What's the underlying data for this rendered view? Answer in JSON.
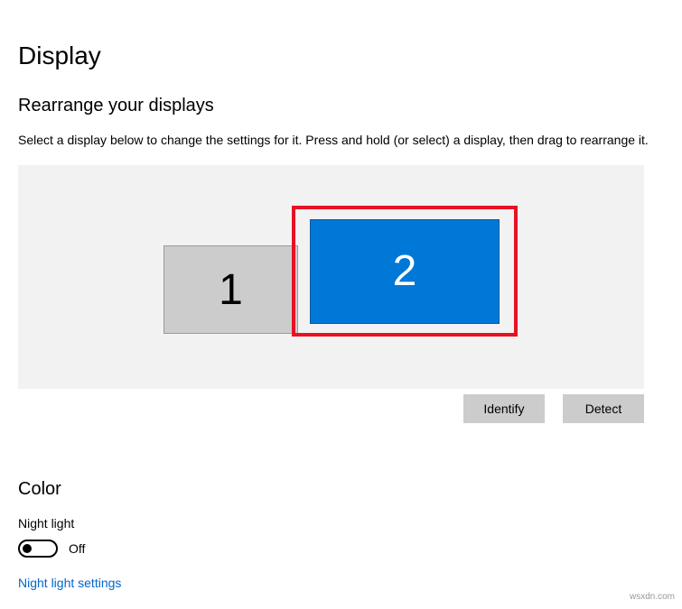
{
  "page": {
    "title": "Display"
  },
  "rearrange": {
    "heading": "Rearrange your displays",
    "description": "Select a display below to change the settings for it. Press and hold (or select) a display, then drag to rearrange it.",
    "display1": "1",
    "display2": "2",
    "identify_label": "Identify",
    "detect_label": "Detect"
  },
  "color": {
    "heading": "Color",
    "night_light_label": "Night light",
    "night_light_state": "Off",
    "night_light_link": "Night light settings"
  },
  "watermark": "wsxdn.com"
}
